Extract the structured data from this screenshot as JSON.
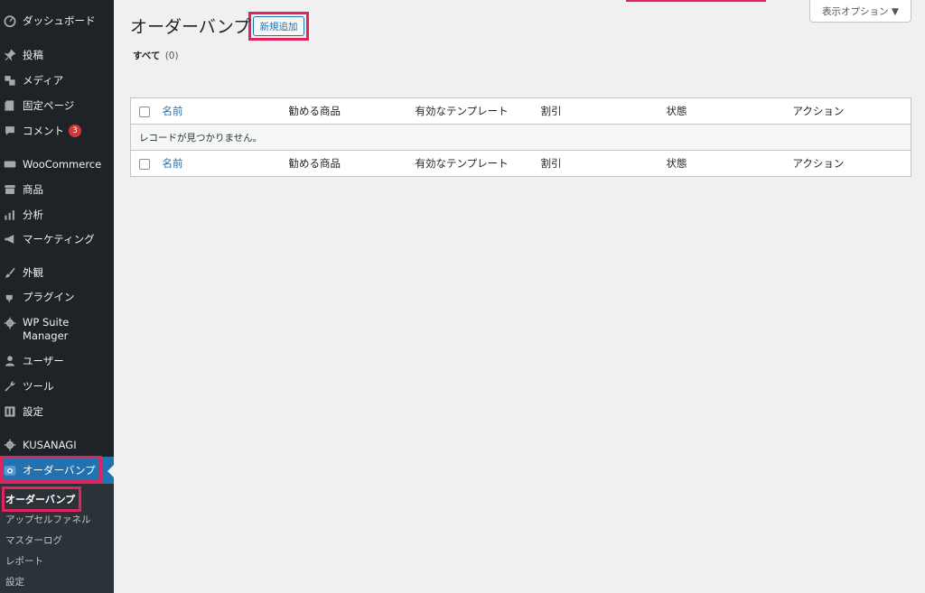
{
  "sidebar": {
    "items": [
      {
        "label": "ダッシュボード",
        "icon": "dashboard-icon"
      },
      {
        "label": "投稿",
        "icon": "pin-icon"
      },
      {
        "label": "メディア",
        "icon": "media-icon"
      },
      {
        "label": "固定ページ",
        "icon": "page-icon"
      },
      {
        "label": "コメント",
        "icon": "comment-icon",
        "badge": "3"
      },
      {
        "label": "WooCommerce",
        "icon": "woo-icon"
      },
      {
        "label": "商品",
        "icon": "archive-icon"
      },
      {
        "label": "分析",
        "icon": "bar-chart-icon"
      },
      {
        "label": "マーケティング",
        "icon": "megaphone-icon"
      },
      {
        "label": "外観",
        "icon": "brush-icon"
      },
      {
        "label": "プラグイン",
        "icon": "plugin-icon"
      },
      {
        "label": "WP Suite\nManager",
        "icon": "gear-icon"
      },
      {
        "label": "ユーザー",
        "icon": "user-icon"
      },
      {
        "label": "ツール",
        "icon": "wrench-icon"
      },
      {
        "label": "設定",
        "icon": "settings-icon"
      },
      {
        "label": "KUSANAGI",
        "icon": "gear-icon"
      },
      {
        "label": "オーダーバンプ",
        "icon": "order-bump-icon"
      }
    ],
    "submenu": [
      "オーダーバンプ",
      "アップセルファネル",
      "マスターログ",
      "レポート",
      "設定"
    ]
  },
  "header": {
    "title": "オーダーバンプ",
    "add_new": "新規追加",
    "screen_options": "表示オプション ▼"
  },
  "filter": {
    "all_label": "すべて",
    "all_count": "(0)"
  },
  "table": {
    "columns": [
      "名前",
      "勧める商品",
      "有効なテンプレート",
      "割引",
      "状態",
      "アクション"
    ],
    "empty_message": "レコードが見つかりません。"
  },
  "colors": {
    "sidebar_bg": "#1d2327",
    "submenu_bg": "#2c3338",
    "accent": "#2271b1",
    "highlight": "#e0245e",
    "badge": "#d63638"
  }
}
